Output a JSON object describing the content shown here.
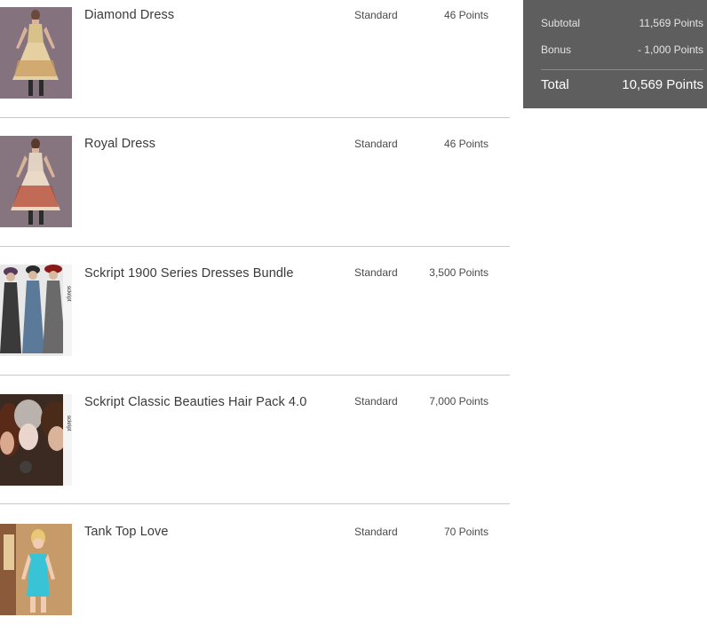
{
  "cart": {
    "items": [
      {
        "title": "Diamond Dress",
        "license": "Standard",
        "price": "46 Points",
        "thumb_icon": "diamond-dress-thumbnail"
      },
      {
        "title": "Royal Dress",
        "license": "Standard",
        "price": "46 Points",
        "thumb_icon": "royal-dress-thumbnail"
      },
      {
        "title": "Sckript 1900 Series Dresses Bundle",
        "license": "Standard",
        "price": "3,500 Points",
        "thumb_icon": "dresses-bundle-thumbnail"
      },
      {
        "title": "Sckript Classic Beauties Hair Pack 4.0",
        "license": "Standard",
        "price": "7,000 Points",
        "thumb_icon": "hair-pack-thumbnail"
      },
      {
        "title": "Tank Top Love",
        "license": "Standard",
        "price": "70 Points",
        "thumb_icon": "tank-top-thumbnail"
      }
    ]
  },
  "summary": {
    "subtotal_label": "Subtotal",
    "subtotal_value": "11,569 Points",
    "bonus_label": "Bonus",
    "bonus_value": "- 1,000 Points",
    "total_label": "Total",
    "total_value": "10,569 Points"
  },
  "colors": {
    "summary_bg": "#5e5e5e",
    "divider": "#c9c9c9"
  }
}
